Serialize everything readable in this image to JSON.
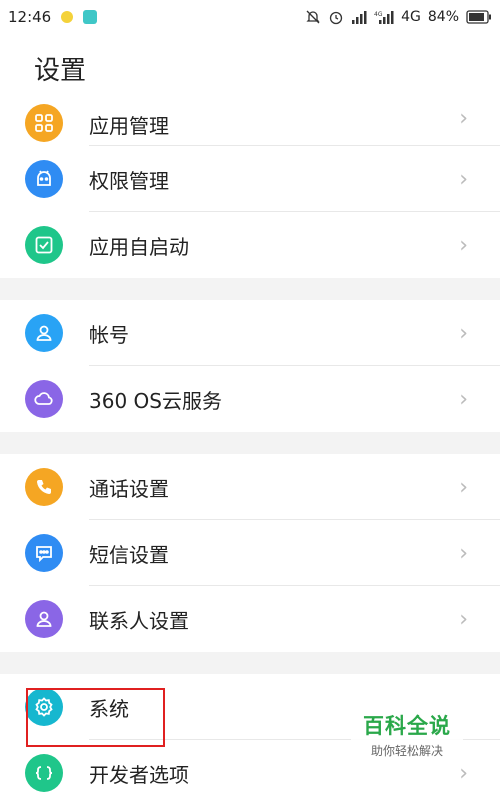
{
  "status": {
    "time": "12:46",
    "network": "4G",
    "battery": "84%"
  },
  "header": {
    "title": "设置"
  },
  "groups": [
    {
      "items": [
        {
          "label": "应用管理",
          "icon": "grid-icon",
          "color": "#f5a623"
        },
        {
          "label": "权限管理",
          "icon": "android-icon",
          "color": "#2f8cf3"
        },
        {
          "label": "应用自启动",
          "icon": "checkbox-icon",
          "color": "#1fc68a"
        }
      ]
    },
    {
      "items": [
        {
          "label": "帐号",
          "icon": "user-icon",
          "color": "#29a3f5"
        },
        {
          "label": "360 OS云服务",
          "icon": "cloud-icon",
          "color": "#8a66e6"
        }
      ]
    },
    {
      "items": [
        {
          "label": "通话设置",
          "icon": "phone-icon",
          "color": "#f5a623"
        },
        {
          "label": "短信设置",
          "icon": "message-icon",
          "color": "#2f8cf3"
        },
        {
          "label": "联系人设置",
          "icon": "contact-icon",
          "color": "#8a66e6"
        }
      ]
    },
    {
      "items": [
        {
          "label": "系统",
          "icon": "gear-icon",
          "color": "#16b7cf"
        },
        {
          "label": "开发者选项",
          "icon": "code-icon",
          "color": "#1fc68a"
        }
      ]
    }
  ],
  "watermark": {
    "title": "百科全说",
    "subtitle": "助你轻松解决"
  }
}
